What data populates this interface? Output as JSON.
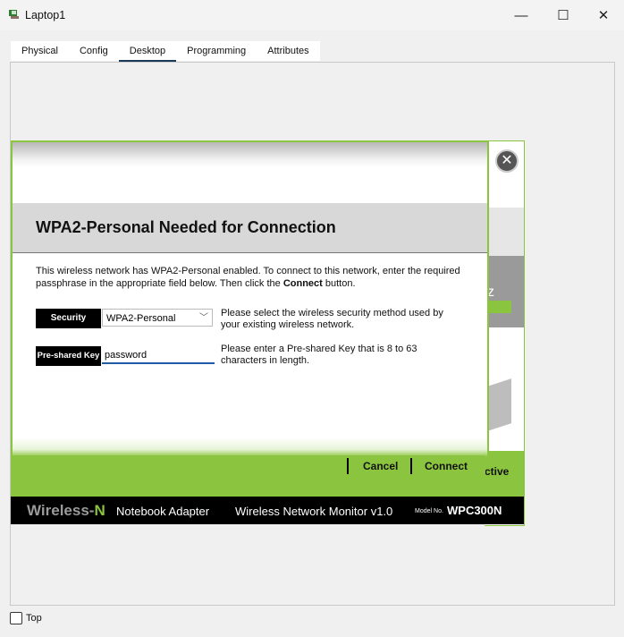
{
  "window": {
    "title": "Laptop1",
    "minimize": "—",
    "maximize": "☐",
    "close": "✕"
  },
  "tabs": [
    {
      "label": "Physical"
    },
    {
      "label": "Config"
    },
    {
      "label": "Desktop",
      "active": true
    },
    {
      "label": "Programming"
    },
    {
      "label": "Attributes"
    }
  ],
  "background_window": {
    "close": "✕",
    "partial_text_z": "z",
    "partial_text_active": "ctive"
  },
  "dialog": {
    "heading": "WPA2-Personal Needed for Connection",
    "description_part1": "This wireless network has WPA2-Personal enabled. To connect to this network, enter the required passphrase in the appropriate field below. Then click the ",
    "description_bold": "Connect",
    "description_part2": " button.",
    "security_label": "Security",
    "security_value": "WPA2-Personal",
    "security_hint": "Please select the wireless security method used by your existing wireless network.",
    "psk_label": "Pre-shared Key",
    "psk_value": "password",
    "psk_hint": "Please enter a Pre-shared Key that is 8 to 63 characters in length.",
    "cancel": "Cancel",
    "connect": "Connect"
  },
  "footer": {
    "brand_prefix": "Wireless-",
    "brand_n": "N",
    "product": "Notebook Adapter",
    "monitor": "Wireless Network Monitor  v1.0",
    "model_label": "Model No.",
    "model": "WPC300N"
  },
  "bottom": {
    "top_label": "Top",
    "top_checked": false
  },
  "colors": {
    "accent_green": "#8bc53f",
    "input_underline": "#1f5aa6"
  }
}
